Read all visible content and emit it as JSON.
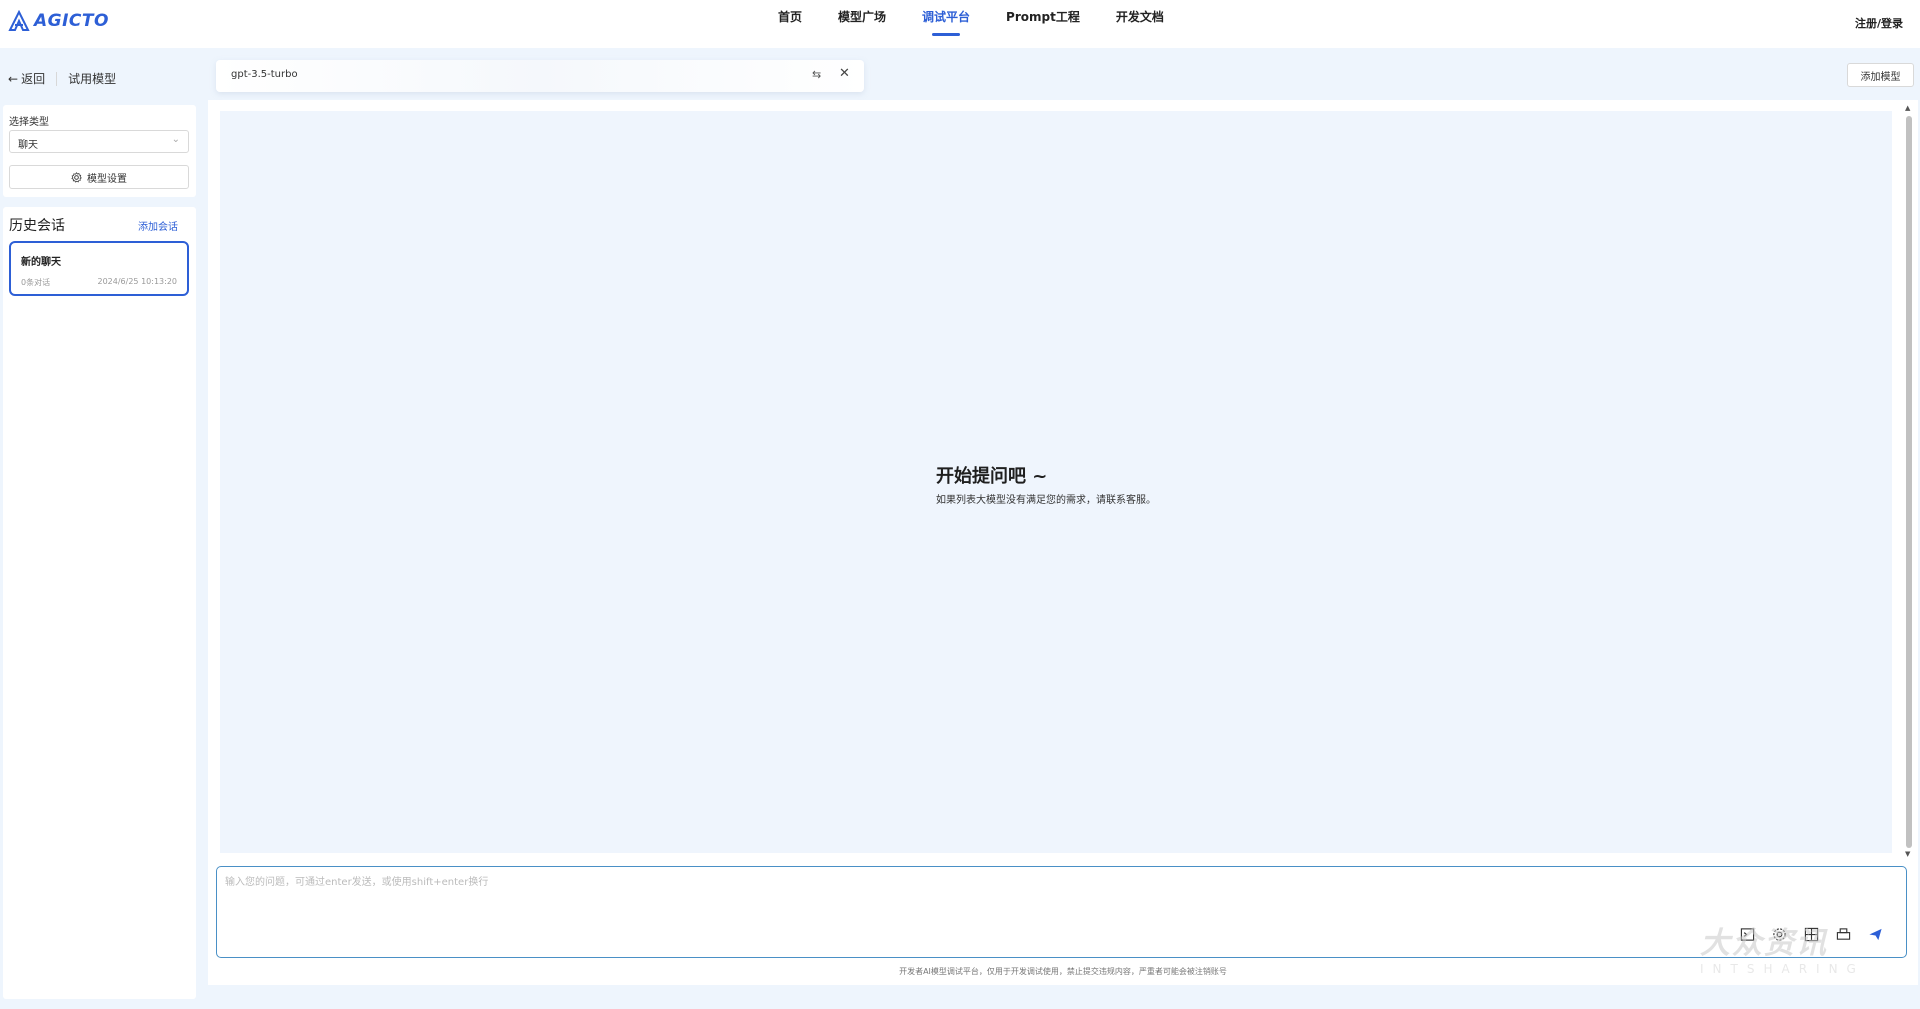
{
  "brand": {
    "name": "AGICTO",
    "color": "#2d5fd6"
  },
  "nav": {
    "items": [
      {
        "label": "首页"
      },
      {
        "label": "模型广场"
      },
      {
        "label": "调试平台"
      },
      {
        "label": "Prompt工程"
      },
      {
        "label": "开发文档"
      }
    ],
    "active_index": 2,
    "login_label": "注册/登录"
  },
  "sidebar": {
    "back_label": "返回",
    "section_title": "试用模型",
    "type_label": "选择类型",
    "type_value": "聊天",
    "settings_label": "模型设置",
    "history_title": "历史会话",
    "add_session_label": "添加会话",
    "sessions": [
      {
        "title": "新的聊天",
        "count": "0条对话",
        "time": "2024/6/25 10:13:20"
      }
    ]
  },
  "model_tab": {
    "name": "gpt-3.5-turbo",
    "swap_icon": "swap-icon",
    "close_icon": "close-icon"
  },
  "add_model_label": "添加模型",
  "chat": {
    "empty_title": "开始提问吧 ~",
    "empty_subtitle": "如果列表大模型没有满足您的需求，请联系客服。",
    "input_placeholder": "输入您的问题，可通过enter发送，或使用shift+enter换行",
    "tools": [
      "terminal-icon",
      "gear-icon",
      "image-icon",
      "print-icon",
      "send-icon"
    ],
    "footer_note": "开发者AI模型调试平台，仅用于开发调试使用，禁止提交违规内容，严重者可能会被注销账号"
  },
  "watermark": {
    "text_cn": "大众资讯",
    "text_en": "INTSHARING"
  }
}
